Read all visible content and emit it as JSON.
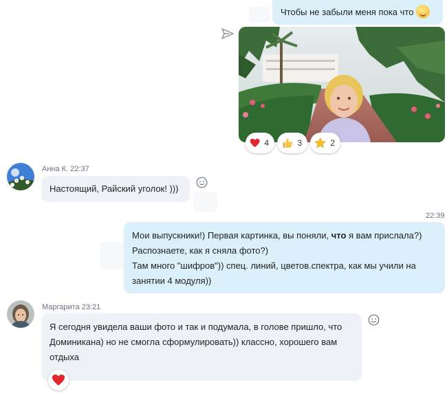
{
  "top_message": {
    "text": "Чтобы не забыли меня пока что",
    "emoji": "smirk-emoji"
  },
  "photo": {
    "alt_icon": "photo-garden-woman"
  },
  "reactions": [
    {
      "icon": "heart-icon",
      "count": "4"
    },
    {
      "icon": "thumbs-up-icon",
      "count": "3"
    },
    {
      "icon": "star-icon",
      "count": "2"
    }
  ],
  "anna": {
    "sender": "Анна К. 22:37",
    "text": "Настоящий, Райский уголок! )))"
  },
  "me": {
    "time": "22:39",
    "line1_before": "Мои выпускники!) Первая картинка, вы поняли, ",
    "line1_bold": "что",
    "line1_after": " я вам прислала?)",
    "line2": "Распознаете, как я сняла фото?)",
    "line3": "Там много \"шифров\")) спец. линий, цветов.спектра, как мы учили на",
    "line4": "занятии 4 модуля))"
  },
  "margarita": {
    "sender": "Маргарита 23:21",
    "line1": "Я сегодня увидела ваши фото и так и подумала, в голове пришло, что",
    "line2": "Доминикана) но не смогла сформулировать)) классно, хорошего вам",
    "line3": "отдыха",
    "reaction_icon": "heart-icon"
  },
  "colors": {
    "outgoing_bubble": "#dcf0fb",
    "incoming_bubble": "#eef1f5",
    "heart": "#e2272f"
  }
}
